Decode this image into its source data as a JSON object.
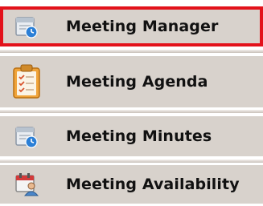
{
  "menu": {
    "items": [
      {
        "label": "Meeting Manager",
        "icon": "calendar-clock-icon",
        "selected": true
      },
      {
        "label": "Meeting Agenda",
        "icon": "clipboard-checklist-icon",
        "selected": false
      },
      {
        "label": "Meeting Minutes",
        "icon": "calendar-clock-icon",
        "selected": false
      },
      {
        "label": "Meeting Availability",
        "icon": "calendar-person-icon",
        "selected": false
      }
    ]
  },
  "colors": {
    "selection_border": "#e3121b",
    "item_background": "#d8d2cc",
    "text": "#111111"
  }
}
